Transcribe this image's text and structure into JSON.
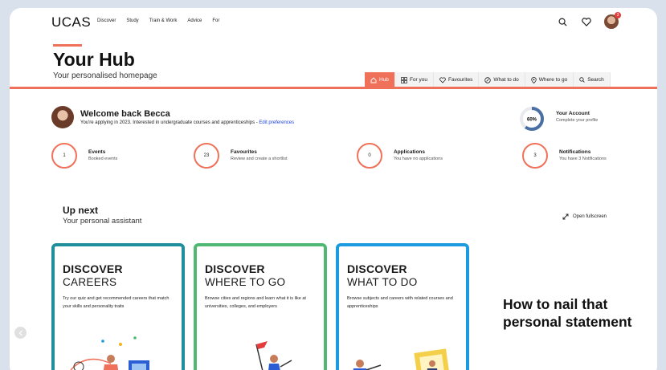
{
  "header": {
    "logo": "UCAS",
    "nav": [
      "Discover",
      "Study",
      "Train & Work",
      "Advice",
      "For"
    ],
    "notification_count": "3"
  },
  "hub": {
    "title": "Your Hub",
    "subtitle": "Your personalised homepage",
    "tabs": [
      "Hub",
      "For you",
      "Favourites",
      "What to do",
      "Where to go",
      "Search"
    ]
  },
  "welcome": {
    "title": "Welcome back Becca",
    "text": "You're applying in 2023. Interested in undergraduate courses and apprenticeships - ",
    "link": "Edit preferences"
  },
  "account": {
    "percent": "60%",
    "progress": 0.6,
    "title": "Your Account",
    "subtitle": "Complete your profile"
  },
  "stats": [
    {
      "value": "1",
      "title": "Events",
      "subtitle": "Booked events"
    },
    {
      "value": "23",
      "title": "Favourites",
      "subtitle": "Review and create a shortlist"
    },
    {
      "value": "0",
      "title": "Applications",
      "subtitle": "You have no applications"
    },
    {
      "value": "3",
      "title": "Notifications",
      "subtitle": "You have 3 Notifications"
    }
  ],
  "upnext": {
    "title": "Up next",
    "subtitle": "Your personal assistant",
    "fullscreen": "Open fullscreen"
  },
  "cards": [
    {
      "line1": "DISCOVER",
      "line2": "CAREERS",
      "text": "Try our quiz and get recommended careers that match your skills and personality traits",
      "color": "#1e8f9b"
    },
    {
      "line1": "DISCOVER",
      "line2": "WHERE TO GO",
      "text": "Browse cities and regions and learn what it is like at universities, colleges, and employers",
      "color": "#4fb873"
    },
    {
      "line1": "DISCOVER",
      "line2": "WHAT TO DO",
      "text": "Browse subjects and careers with related courses and apprenticeships",
      "color": "#1d9be0"
    }
  ],
  "promo": {
    "line1": "How to nail that",
    "line2": "personal statement"
  },
  "colors": {
    "accent": "#f0715a",
    "link": "#1a40d8"
  }
}
